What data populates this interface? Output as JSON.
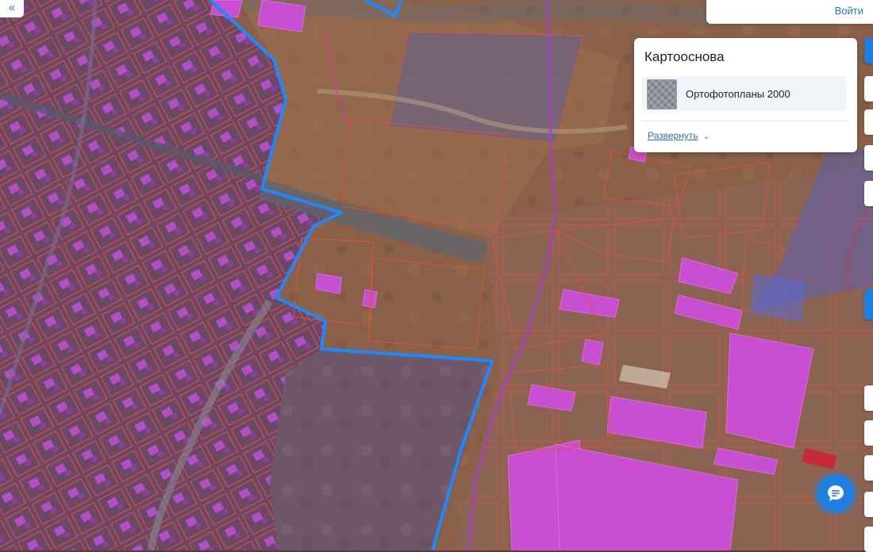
{
  "header": {
    "login_label": "Войти"
  },
  "layers_panel": {
    "title": "Картооснова",
    "active_layer": "Ортофотопланы 2000",
    "expand_label": "Развернуть"
  },
  "controls": {
    "collapse_icon": "double-chevron-left-icon",
    "chat_icon": "chat-bubble-icon"
  },
  "map": {
    "type": "orthophoto with cadastral parcels overlay",
    "colors": {
      "parcel_outline": "#e0523a",
      "building_fill": "#c84fd2",
      "boundary_line": "#1e88ff",
      "zone_fill": "#b07b4e",
      "residential_tint": "#7a4a7a"
    }
  }
}
